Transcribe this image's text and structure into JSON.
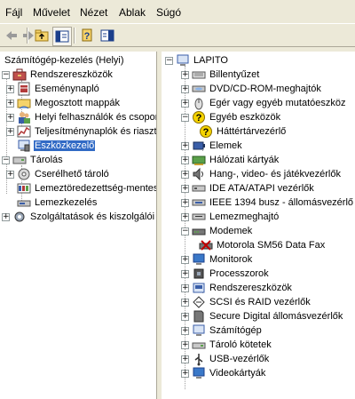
{
  "menubar": {
    "items": [
      "Fájl",
      "Művelet",
      "Nézet",
      "Ablak",
      "Súgó"
    ]
  },
  "left_tree": {
    "root": "Számítógép-kezelés (Helyi)",
    "system_tools": "Rendszereszközök",
    "system_children": [
      "Eseménynapló",
      "Megosztott mappák",
      "Helyi felhasználók és csoportok",
      "Teljesítménynaplók és riasztások",
      "Eszközkezelő"
    ],
    "storage": "Tárolás",
    "storage_children": [
      "Cserélhető tároló",
      "Lemeztöredezettség-mentesítő",
      "Lemezkezelés"
    ],
    "services": "Szolgáltatások és kiszolgálói alkalmazások"
  },
  "right_tree": {
    "root": "LAPITO",
    "items": [
      "Billentyűzet",
      "DVD/CD-ROM-meghajtók",
      "Egér vagy egyéb mutatóeszköz",
      "Egyéb eszközök",
      "Háttértárvezérlő",
      "Elemek",
      "Hálózati kártyák",
      "Hang-, video- és játékvezérlők",
      "IDE ATA/ATAPI vezérlők",
      "IEEE 1394 busz - állomásvezérlő",
      "Lemezmeghajtó",
      "Modemek",
      "Motorola SM56 Data Fax",
      "Monitorok",
      "Processzorok",
      "Rendszereszközök",
      "SCSI és RAID vezérlők",
      "Secure Digital állomásvezérlők",
      "Számítógép",
      "Tároló kötetek",
      "USB-vezérlők",
      "Videokártyák"
    ]
  }
}
